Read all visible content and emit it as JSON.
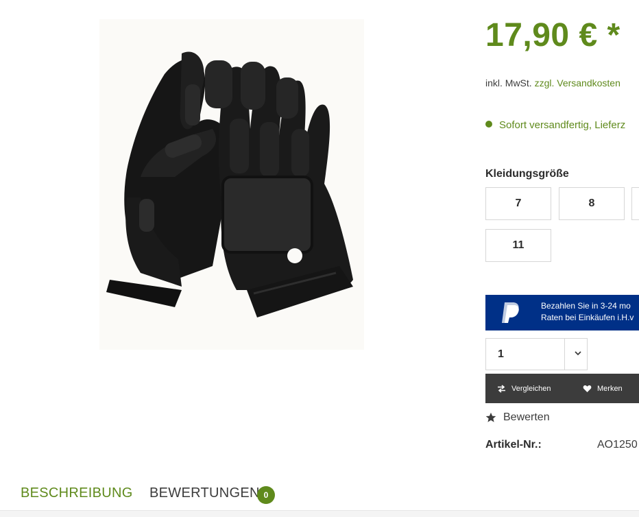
{
  "product": {
    "price": "17,90 € *",
    "tax_text": "inkl. MwSt.",
    "shipping_link": "zzgl. Versandkosten",
    "delivery_status": "Sofort versandfertig, Lieferz",
    "size_label": "Kleidungsgröße",
    "sizes": [
      "7",
      "8",
      "11"
    ],
    "quantity": "1",
    "article_label": "Artikel-Nr.:",
    "article_number": "AO1250"
  },
  "paypal": {
    "line1": "Bezahlen Sie in 3-24 mo",
    "line2": "Raten bei Einkäufen i.H.v"
  },
  "actions": {
    "compare": "Vergleichen",
    "wishlist": "Merken",
    "rate": "Bewerten"
  },
  "tabs": {
    "description": "BESCHREIBUNG",
    "reviews": "BEWERTUNGEN",
    "reviews_count": "0"
  },
  "colors": {
    "accent": "#5f8a1c",
    "paypal_blue": "#003087",
    "action_bar": "#3c3c3c"
  }
}
